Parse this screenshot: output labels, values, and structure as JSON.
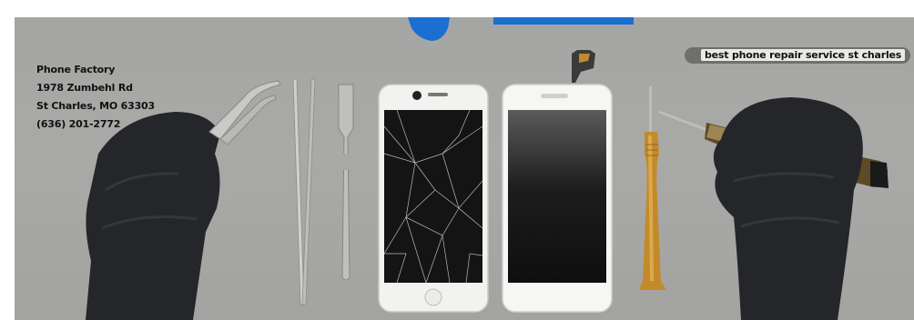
{
  "address": {
    "name": "Phone Factory",
    "street": "1978 Zumbehl Rd",
    "city": "St Charles, MO 63303",
    "phone": "(636) 201-2772"
  },
  "tag": {
    "text": "best phone repair service st charles"
  },
  "scene": {
    "icons": [
      "glove-left",
      "tweezers",
      "tweezers-straight",
      "spudger",
      "broken-phone",
      "new-phone-screen",
      "screwdriver",
      "glove-right"
    ],
    "colors": {
      "background": "#a7a7a5",
      "glove": "#24262a",
      "gold": "#c48a2a",
      "blue_tool": "#1b6fd1"
    }
  }
}
